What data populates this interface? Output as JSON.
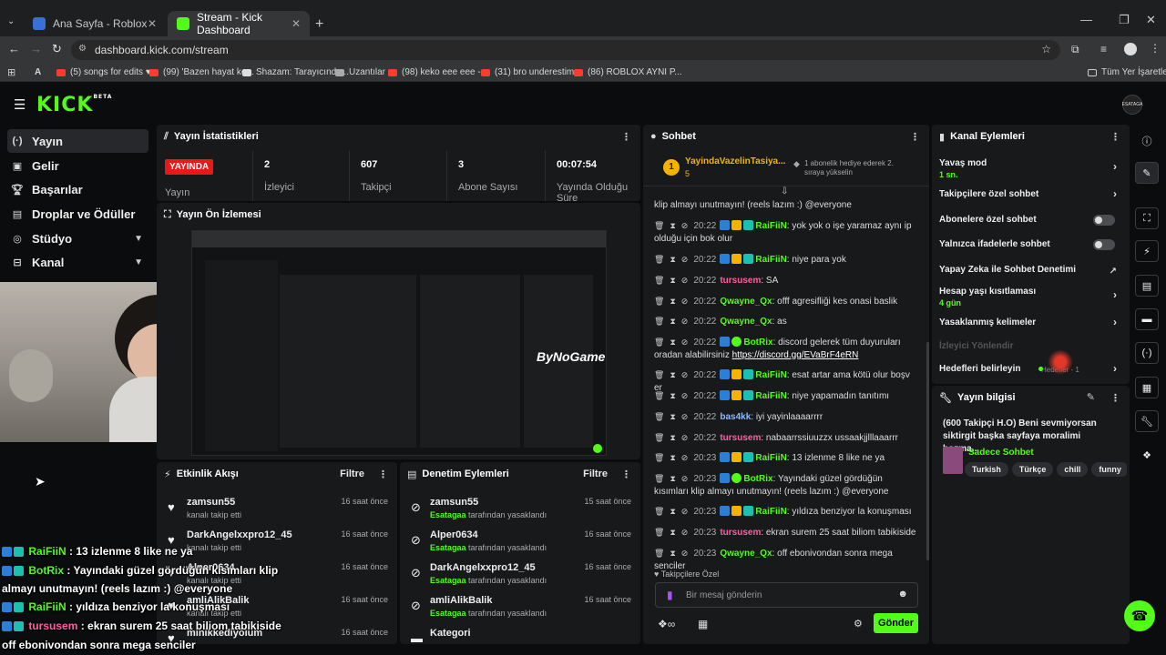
{
  "browser": {
    "tabs": [
      {
        "title": "Ana Sayfa - Roblox"
      },
      {
        "title": "Stream - Kick Dashboard"
      }
    ],
    "url": "dashboard.kick.com/stream",
    "bookmarks": [
      "A",
      "(5) songs for edits ♥...",
      "(99) 'Bazen hayat ko...",
      "Shazam: Tarayıcında...",
      "Uzantılar",
      "(98) keko eee eee -...",
      "(31) bro underestim...",
      "(86) ROBLOX AYNI P..."
    ],
    "all_bookmarks": "Tüm Yer İşaretleri"
  },
  "app": {
    "logo": "KICK",
    "logo_sup": "BETA",
    "avatar_label": "ESATAGA"
  },
  "sidebar": {
    "items": [
      {
        "label": "Yayın",
        "icon": "broadcast-icon"
      },
      {
        "label": "Gelir",
        "icon": "money-icon"
      },
      {
        "label": "Başarılar",
        "icon": "trophy-icon"
      },
      {
        "label": "Droplar ve Ödüller",
        "icon": "gift-icon"
      },
      {
        "label": "Stüdyo",
        "icon": "studio-icon"
      },
      {
        "label": "Kanal",
        "icon": "channel-icon"
      }
    ]
  },
  "stats": {
    "title": "Yayın İstatistikleri",
    "live_badge": "YAYINDA",
    "live_label": "Yayın",
    "cells": [
      {
        "value": "2",
        "label": "İzleyici"
      },
      {
        "value": "607",
        "label": "Takipçi"
      },
      {
        "value": "3",
        "label": "Abone Sayısı"
      },
      {
        "value": "00:07:54",
        "label": "Yayında Olduğu Süre"
      }
    ]
  },
  "preview": {
    "title": "Yayın Ön İzlemesi",
    "watermark": "ByNoGame"
  },
  "activity": {
    "title": "Etkinlik Akışı",
    "filter": "Filtre",
    "rows": [
      {
        "name": "zamsun55",
        "sub": "kanalı takip etti",
        "time": "16 saat önce"
      },
      {
        "name": "DarkAngelxxpro12_45",
        "sub": "kanalı takip etti",
        "time": "16 saat önce"
      },
      {
        "name": "Alper0634",
        "sub": "kanalı takip etti",
        "time": "16 saat önce"
      },
      {
        "name": "amliAlikBalik",
        "sub": "kanalı takip etti",
        "time": "16 saat önce"
      },
      {
        "name": "minikkediyolum",
        "sub": "",
        "time": "16 saat önce"
      }
    ]
  },
  "moderation": {
    "title": "Denetim Eylemleri",
    "filter": "Filtre",
    "rows": [
      {
        "name": "zamsun55",
        "by": "Esatagaa",
        "sub": "tarafından yasaklandı",
        "time": "15 saat önce"
      },
      {
        "name": "Alper0634",
        "by": "Esatagaa",
        "sub": "tarafından yasaklandı",
        "time": "16 saat önce"
      },
      {
        "name": "DarkAngelxxpro12_45",
        "by": "Esatagaa",
        "sub": "tarafından yasaklandı",
        "time": "16 saat önce"
      },
      {
        "name": "amliAlikBalik",
        "by": "Esatagaa",
        "sub": "tarafından yasaklandı",
        "time": "16 saat önce"
      },
      {
        "name": "Kategori",
        "by": "",
        "sub": "",
        "time": ""
      }
    ]
  },
  "chat": {
    "title": "Sohbet",
    "pinned_user": "YayindaVazelinTasiya...",
    "pinned_count": "5",
    "pinned_rank": "1",
    "gift_note": "1 abonelik hediye ederek 2. sıraya yükselin",
    "first_line": "klip almayı unutmayın! (reels lazım :) @everyone",
    "messages": [
      {
        "time": "20:22",
        "user": "RaiFiiN",
        "color": "#53fc18",
        "text": "yok yok o işe yaramaz aynı ip olduğu için bok olur"
      },
      {
        "time": "20:22",
        "user": "RaiFiiN",
        "color": "#53fc18",
        "text": "niye para yok"
      },
      {
        "time": "20:22",
        "user": "tursusem",
        "color": "#ff5fa2",
        "text": "SA"
      },
      {
        "time": "20:22",
        "user": "Qwayne_Qx",
        "color": "#53fc18",
        "text": "offf agresifliği kes onasi baslik"
      },
      {
        "time": "20:22",
        "user": "Qwayne_Qx",
        "color": "#53fc18",
        "text": "as"
      },
      {
        "time": "20:22",
        "user": "BotRix",
        "color": "#53fc18",
        "text": "discord gelerek tüm duyuruları oradan alabilirsiniz",
        "link": "https://discord.gg/EVaBrF4eRN"
      },
      {
        "time": "20:22",
        "user": "RaiFiiN",
        "color": "#53fc18",
        "text": "esat artar ama kötü olur boşv er"
      },
      {
        "time": "20:22",
        "user": "RaiFiiN",
        "color": "#53fc18",
        "text": "niye yapamadın tanıtımı"
      },
      {
        "time": "20:22",
        "user": "bas4kk",
        "color": "#8fb8ff",
        "text": "iyi yayinlaaaarrrr"
      },
      {
        "time": "20:22",
        "user": "tursusem",
        "color": "#ff5fa2",
        "text": "nabaarrssiuuzzx ussaakjjlllaaarrr"
      },
      {
        "time": "20:23",
        "user": "RaiFiiN",
        "color": "#53fc18",
        "text": "13 izlenme 8 like ne ya"
      },
      {
        "time": "20:23",
        "user": "BotRix",
        "color": "#53fc18",
        "text": "Yayındaki güzel gördüğün kısımları klip almayı unutmayın! (reels lazım :) @everyone"
      },
      {
        "time": "20:23",
        "user": "RaiFiiN",
        "color": "#53fc18",
        "text": "yıldıza benziyor la konuşması"
      },
      {
        "time": "20:23",
        "user": "tursusem",
        "color": "#ff5fa2",
        "text": "ekran surem 25 saat biliom tabikiside"
      },
      {
        "time": "20:23",
        "user": "Qwayne_Qx",
        "color": "#53fc18",
        "text": "off ebonivondan sonra mega senciler"
      }
    ],
    "followers_only": "Takipçilere Özel",
    "input_placeholder": "Bir mesaj gönderin",
    "send": "Gönder"
  },
  "channel": {
    "title": "Kanal Eylemleri",
    "rows": [
      {
        "label": "Yavaş mod",
        "sub": "1 sn."
      },
      {
        "label": "Takipçilere özel sohbet",
        "sub": ""
      },
      {
        "label": "Abonelere özel sohbet",
        "sub": ""
      },
      {
        "label": "Yalnızca ifadelerle sohbet",
        "sub": ""
      },
      {
        "label": "Yapay Zeka ile Sohbet Denetimi",
        "sub": ""
      },
      {
        "label": "Hesap yaşı kısıtlaması",
        "sub": "4 gün"
      },
      {
        "label": "Yasaklanmış kelimeler",
        "sub": ""
      },
      {
        "label": "İzleyici Yönlendir",
        "sub": ""
      },
      {
        "label": "Hedefleri belirleyin",
        "sub": "Hedefler - 1"
      }
    ]
  },
  "stream_info": {
    "title": "Yayın bilgisi",
    "stream_title": "(600 Takipçi H.O) Beni sevmiyorsan siktirgit başka sayfaya moralimi bozma...",
    "category": "Sadece Sohbet",
    "tags": [
      "Turkish",
      "Türkçe",
      "chill",
      "funny"
    ]
  },
  "overlay": {
    "lines": [
      {
        "user": "RaiFiiN",
        "color": "#53fc18",
        "text": ": 13 izlenme 8 like ne ya"
      },
      {
        "user": "BotRix",
        "color": "#53fc18",
        "text": ": Yayındaki güzel gördüğün kısımları klip"
      },
      {
        "user": "",
        "color": "#ffffff",
        "text": "almayı unutmayın! (reels lazım :) @everyone"
      },
      {
        "user": "RaiFiiN",
        "color": "#53fc18",
        "text": ": yıldıza benziyor la konuşması"
      },
      {
        "user": "tursusem",
        "color": "#ff5fa2",
        "text": ": ekran surem 25 saat biliom tabikiside"
      },
      {
        "user": "",
        "color": "#ffffff",
        "text": "off ebonivondan sonra mega senciler"
      }
    ]
  }
}
